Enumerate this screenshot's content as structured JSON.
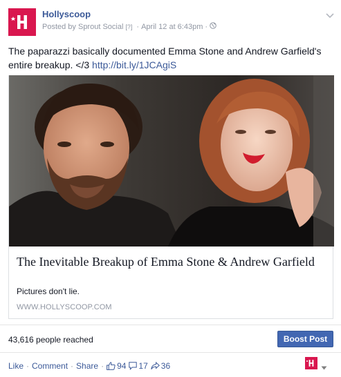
{
  "post": {
    "page_name": "Hollyscoop",
    "posted_by": "Posted by Sprout Social",
    "help_mark": "[?]",
    "date": "April 12 at 6:43pm",
    "separator": "·",
    "message_text": "The paparazzi basically documented Emma Stone and Andrew Garfield's entire breakup. </3 ",
    "message_link": "http://bit.ly/1JCAgiS",
    "icons": {
      "avatar": "hollyscoop-logo-icon",
      "audience": "globe-icon",
      "menu": "chevron-down-icon"
    }
  },
  "card": {
    "title": "The Inevitable Breakup of Emma Stone & Andrew Garfield",
    "description": "Pictures don't lie.",
    "domain": "WWW.HOLLYSCOOP.COM"
  },
  "reach": {
    "text": "43,616 people reached",
    "boost_label": "Boost Post"
  },
  "actions": {
    "like": "Like",
    "comment": "Comment",
    "share": "Share",
    "likes_count": "94",
    "comments_count": "17",
    "shares_count": "36"
  },
  "colors": {
    "brand": "#d9174f",
    "link": "#3b5998",
    "boost": "#4267b2",
    "meta": "#9197a3"
  }
}
